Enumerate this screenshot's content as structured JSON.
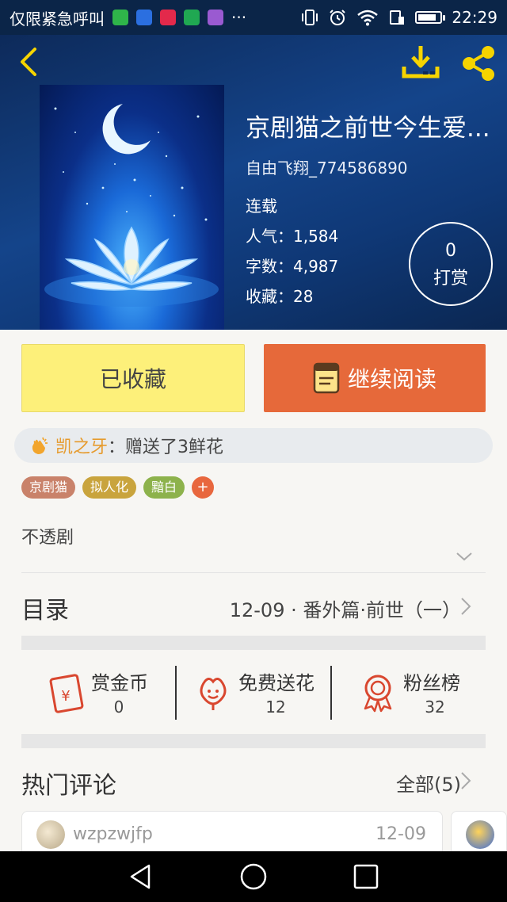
{
  "status_bar": {
    "carrier_text": "仅限紧急呼叫",
    "time": "22:29",
    "more": "···"
  },
  "book": {
    "title": "京剧猫之前世今生爱...",
    "author": "自由飞翔_774586890",
    "status": "连载",
    "popularity": "人气：1,584",
    "word_count": "字数：4,987",
    "favorites": "收藏：28",
    "tip_count": "0",
    "tip_label": "打赏"
  },
  "actions": {
    "favorited_label": "已收藏",
    "continue_label": "继续阅读"
  },
  "gift_notice": {
    "user": "凯之牙",
    "text": "：赠送了3鲜花"
  },
  "tags": [
    {
      "label": "京剧猫",
      "color": "#c9826a"
    },
    {
      "label": "拟人化",
      "color": "#c9a43d"
    },
    {
      "label": "黯白",
      "color": "#8db24c"
    }
  ],
  "tag_add": "+",
  "description": "不透剧",
  "catalog": {
    "label": "目录",
    "latest": "12-09 · 番外篇·前世（一）"
  },
  "stats": {
    "reward_coins_label": "赏金币",
    "reward_coins_value": "0",
    "free_flowers_label": "免费送花",
    "free_flowers_value": "12",
    "fans_label": "粉丝榜",
    "fans_value": "32"
  },
  "comments": {
    "title": "热门评论",
    "all_label": "全部(5)",
    "items": [
      {
        "user": "wzpzwjfp",
        "date": "12-09"
      }
    ]
  },
  "icons": {
    "back": "chevron-left-icon",
    "download": "download-icon",
    "share": "share-icon",
    "book": "book-icon",
    "gift": "clap-icon",
    "reward": "red-envelope-icon",
    "flower": "flower-icon",
    "fans": "medal-icon"
  },
  "colors": {
    "accent_orange": "#e6693a",
    "favorite_yellow": "#fdf07a",
    "icon_yellow": "#f6d400",
    "icon_red": "#d9472f"
  }
}
